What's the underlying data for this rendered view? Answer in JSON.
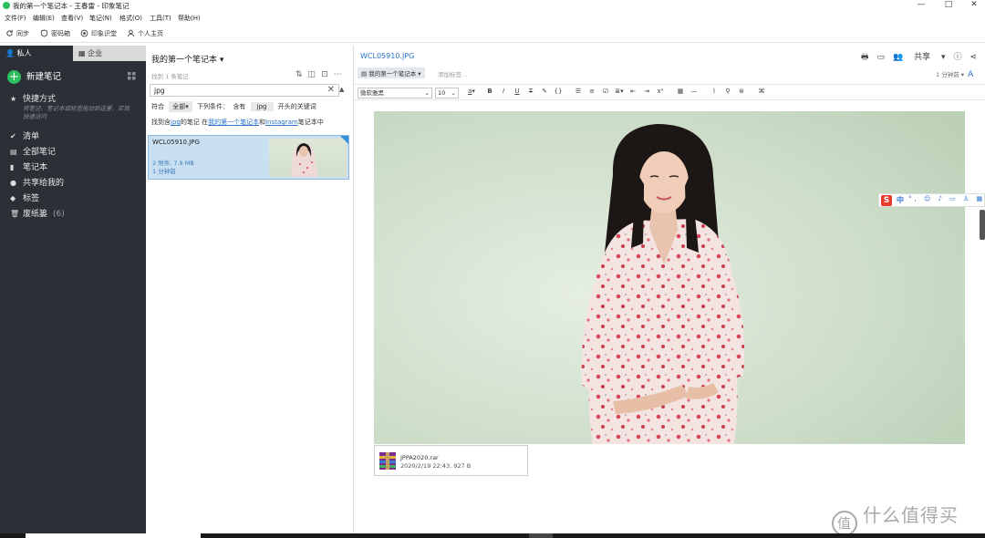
{
  "window": {
    "title": "我的第一个笔记本 - 王春雷 - 印象笔记",
    "controls": [
      "—",
      "□",
      "✕"
    ]
  },
  "menu": [
    "文件(F)",
    "编辑(E)",
    "查看(V)",
    "笔记(N)",
    "格式(O)",
    "工具(T)",
    "帮助(H)"
  ],
  "toolbar": {
    "sync": "同步",
    "vault": "密码箱",
    "workchat": "印象识堂",
    "profile": "个人主页"
  },
  "sidebar": {
    "tab_personal": "私人",
    "tab_business": "企业",
    "new_note": "新建笔记",
    "shortcuts": "快捷方式",
    "shortcuts_hint": "将笔记、笔记本或标签拖动到这里，实现快速访问",
    "items": [
      {
        "label": "清单",
        "icon": "checklist-icon"
      },
      {
        "label": "全部笔记",
        "icon": "all-notes-icon"
      },
      {
        "label": "笔记本",
        "icon": "notebook-icon"
      },
      {
        "label": "共享给我的",
        "icon": "shared-icon"
      },
      {
        "label": "标签",
        "icon": "tag-icon"
      },
      {
        "label": "废纸篓",
        "icon": "trash-icon",
        "count": "(6)"
      }
    ]
  },
  "notelist": {
    "notebook_title": "我的第一个笔记本",
    "found_count": "找到 1 条笔记",
    "search_value": "jpg",
    "cond_match": "符合",
    "cond_all": "全部",
    "cond_label": "下列条件：",
    "cond_contains": "含有",
    "cond_keyword": "jpg",
    "cond_suffix": "开头的关键词",
    "found_prefix": "找到含",
    "found_kw": "jpg",
    "found_mid": "的笔记 在",
    "found_nb1": "我的第一个笔记本",
    "found_and": "和",
    "found_nb2": "Instagram",
    "found_end": "笔记本中",
    "note": {
      "title": "WCL05910.JPG",
      "attachments": "2 附件, 7.9 MB",
      "time": "1 分钟前"
    }
  },
  "editor": {
    "note_title": "WCL05910.JPG",
    "share_label": "共享",
    "notebook_pill": "我的第一个笔记本",
    "add_tag": "添加标签...",
    "updated": "1 分钟前",
    "font": "微软雅黑",
    "size": "10",
    "attachment": {
      "filename": "JPPA2020.rar",
      "meta": "2020/2/19 22:43, 927 B"
    }
  },
  "watermark": {
    "badge": "值",
    "text": "什么值得买"
  },
  "colors": {
    "sidebar_bg": "#2b3036",
    "accent_green": "#2dbe60",
    "selection": "#c9e0f2",
    "link": "#2a74c8"
  }
}
